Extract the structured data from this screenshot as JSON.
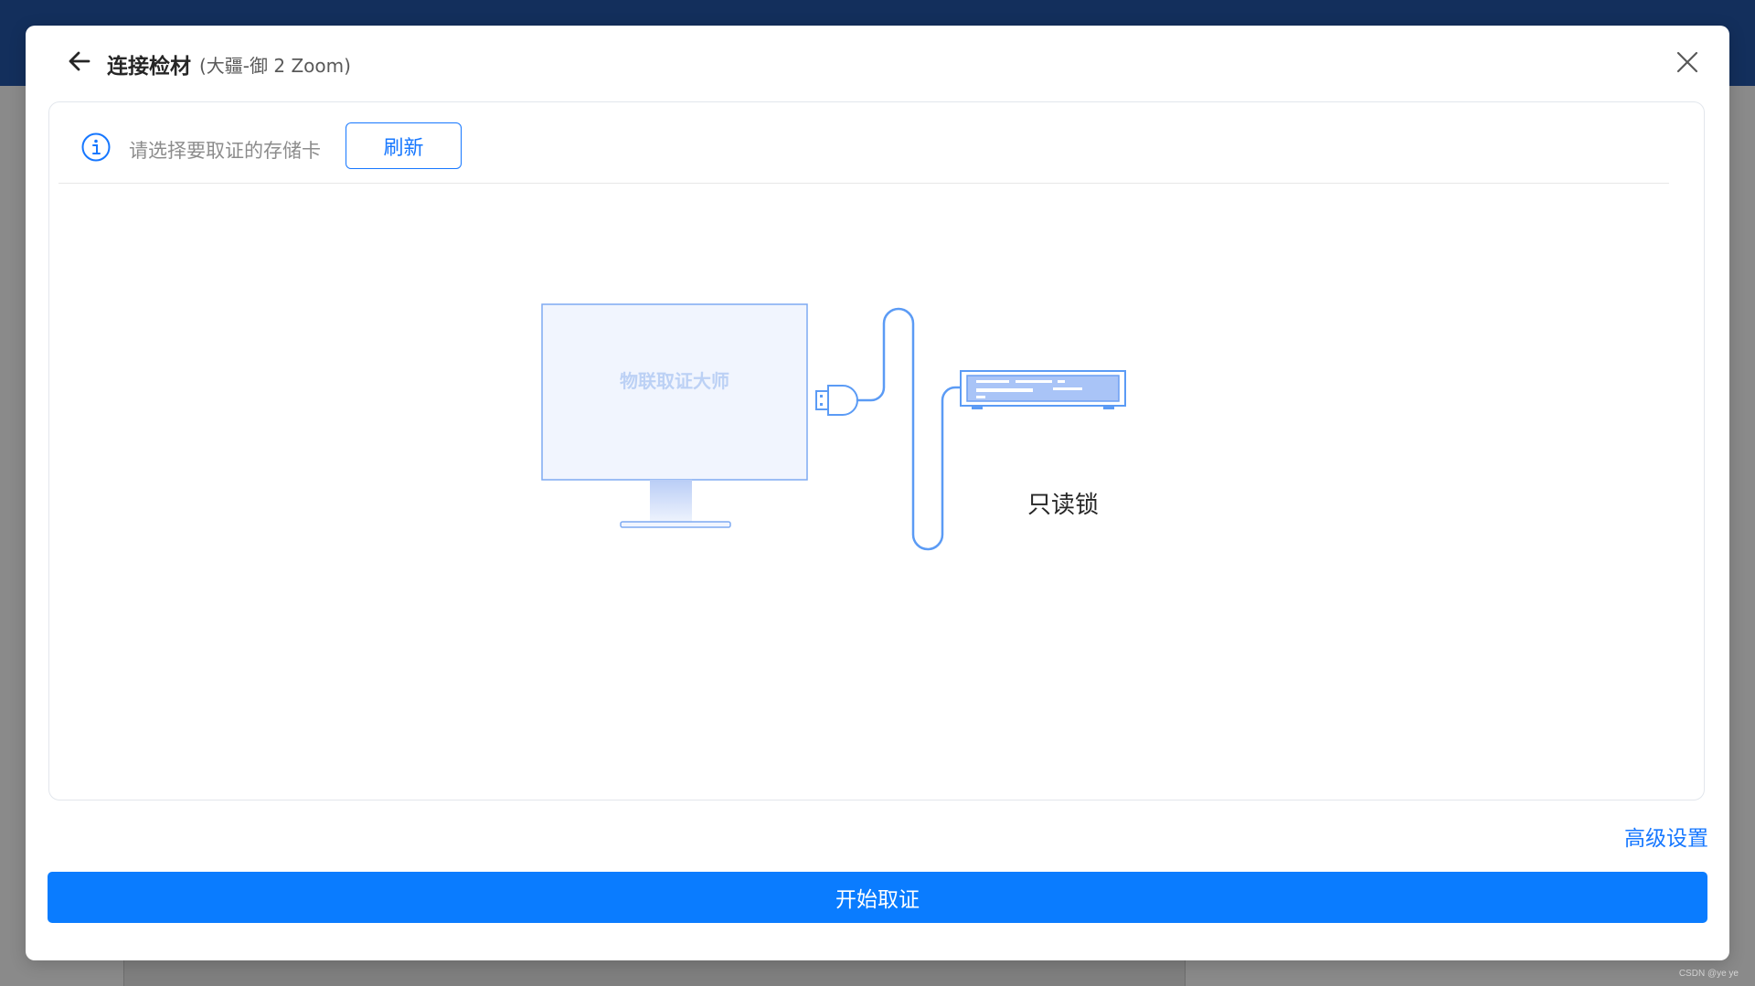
{
  "dialog": {
    "title": "连接检材",
    "subtitle": "(大疆-御 2 Zoom)"
  },
  "toolbar": {
    "hint": "请选择要取证的存储卡",
    "refresh_label": "刷新"
  },
  "illustration": {
    "monitor_text": "物联取证大师",
    "device_label": "只读锁"
  },
  "footer": {
    "advanced_label": "高级设置",
    "start_label": "开始取证"
  },
  "watermark": "CSDN @ye ye",
  "colors": {
    "primary": "#1677ff",
    "header_bg": "#132f5c",
    "illustration_stroke": "#5b9bf5",
    "monitor_fill": "#f1f5fe"
  },
  "icons": {
    "back": "arrow-left-icon",
    "close": "close-icon",
    "info": "info-circle-icon"
  }
}
